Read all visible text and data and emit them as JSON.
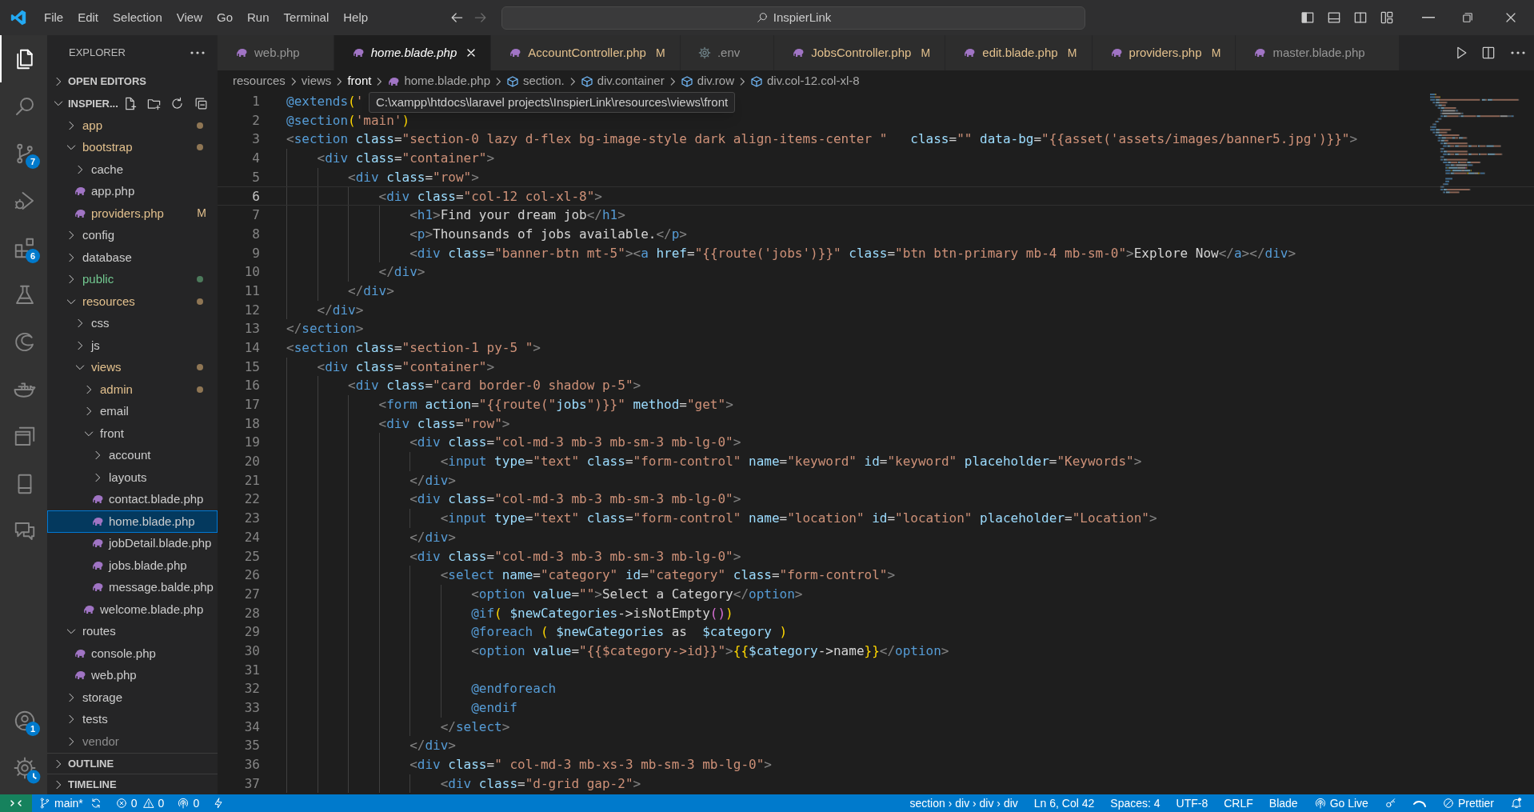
{
  "title_bar": {
    "menus": [
      "File",
      "Edit",
      "Selection",
      "View",
      "Go",
      "Run",
      "Terminal",
      "Help"
    ],
    "search": "InspierLink"
  },
  "activity_bar": {
    "items": [
      {
        "kind": "files",
        "selected": true
      },
      {
        "kind": "search",
        "selected": false
      },
      {
        "kind": "branch",
        "badge": "7",
        "selected": false
      },
      {
        "kind": "debug",
        "selected": false
      },
      {
        "kind": "blocks",
        "badge": "6",
        "selected": false
      },
      {
        "kind": "flask",
        "selected": false
      },
      {
        "kind": "swirl",
        "selected": false
      },
      {
        "kind": "whale",
        "selected": false
      },
      {
        "kind": "windows",
        "selected": false
      },
      {
        "kind": "device",
        "selected": false
      },
      {
        "kind": "chat",
        "selected": false
      }
    ],
    "bottom": [
      {
        "kind": "account",
        "badge": "1",
        "selected": false
      },
      {
        "kind": "gear",
        "selected": false
      }
    ]
  },
  "sidebar": {
    "title": "EXPLORER",
    "open_editors": {
      "label": "OPEN EDITORS",
      "expanded": false
    },
    "root": {
      "label": "INSPIER...",
      "expanded": true
    },
    "tree": [
      {
        "name": "app",
        "kind": "folder",
        "expanded": false,
        "modified": true,
        "untracked": false,
        "ignored": false,
        "dot": true,
        "selected": false
      },
      {
        "name": "bootstrap",
        "kind": "folder",
        "expanded": true,
        "modified": true,
        "untracked": false,
        "ignored": false,
        "dot": true,
        "selected": false,
        "children": [
          {
            "name": "cache",
            "kind": "folder",
            "expanded": false,
            "modified": false,
            "untracked": false,
            "ignored": false,
            "dot": false,
            "selected": false
          },
          {
            "name": "app.php",
            "kind": "file",
            "modified": false,
            "untracked": false,
            "ignored": false,
            "selected": false
          },
          {
            "name": "providers.php",
            "kind": "file",
            "modified": true,
            "untracked": false,
            "ignored": false,
            "badge": "M",
            "selected": false
          }
        ]
      },
      {
        "name": "config",
        "kind": "folder",
        "expanded": false,
        "modified": false,
        "untracked": false,
        "ignored": false,
        "dot": false,
        "selected": false
      },
      {
        "name": "database",
        "kind": "folder",
        "expanded": false,
        "modified": false,
        "untracked": false,
        "ignored": false,
        "dot": false,
        "selected": false
      },
      {
        "name": "public",
        "kind": "folder",
        "expanded": false,
        "modified": false,
        "untracked": true,
        "ignored": false,
        "dot": true,
        "selected": false
      },
      {
        "name": "resources",
        "kind": "folder",
        "expanded": true,
        "modified": true,
        "untracked": false,
        "ignored": false,
        "dot": true,
        "selected": false,
        "children": [
          {
            "name": "css",
            "kind": "folder",
            "expanded": false,
            "modified": false,
            "untracked": false,
            "ignored": false,
            "dot": false,
            "selected": false
          },
          {
            "name": "js",
            "kind": "folder",
            "expanded": false,
            "modified": false,
            "untracked": false,
            "ignored": false,
            "dot": false,
            "selected": false
          },
          {
            "name": "views",
            "kind": "folder",
            "expanded": true,
            "modified": true,
            "untracked": false,
            "ignored": false,
            "dot": true,
            "selected": false,
            "children": [
              {
                "name": "admin",
                "kind": "folder",
                "expanded": false,
                "modified": true,
                "untracked": false,
                "ignored": false,
                "dot": true,
                "selected": false
              },
              {
                "name": "email",
                "kind": "folder",
                "expanded": false,
                "modified": false,
                "untracked": false,
                "ignored": false,
                "dot": false,
                "selected": false
              },
              {
                "name": "front",
                "kind": "folder",
                "expanded": true,
                "modified": false,
                "untracked": false,
                "ignored": false,
                "dot": false,
                "selected": false,
                "children": [
                  {
                    "name": "account",
                    "kind": "folder",
                    "expanded": false,
                    "modified": false,
                    "untracked": false,
                    "ignored": false,
                    "dot": false,
                    "selected": false
                  },
                  {
                    "name": "layouts",
                    "kind": "folder",
                    "expanded": false,
                    "modified": false,
                    "untracked": false,
                    "ignored": false,
                    "dot": false,
                    "selected": false
                  },
                  {
                    "name": "contact.blade.php",
                    "kind": "file",
                    "modified": false,
                    "untracked": false,
                    "ignored": false,
                    "selected": false
                  },
                  {
                    "name": "home.blade.php",
                    "kind": "file",
                    "modified": false,
                    "untracked": false,
                    "ignored": false,
                    "selected": true
                  },
                  {
                    "name": "jobDetail.blade.php",
                    "kind": "file",
                    "modified": false,
                    "untracked": false,
                    "ignored": false,
                    "selected": false
                  },
                  {
                    "name": "jobs.blade.php",
                    "kind": "file",
                    "modified": false,
                    "untracked": false,
                    "ignored": false,
                    "selected": false
                  },
                  {
                    "name": "message.balde.php",
                    "kind": "file",
                    "modified": false,
                    "untracked": false,
                    "ignored": false,
                    "selected": false
                  }
                ]
              },
              {
                "name": "welcome.blade.php",
                "kind": "file",
                "modified": false,
                "untracked": false,
                "ignored": false,
                "selected": false
              }
            ]
          }
        ]
      },
      {
        "name": "routes",
        "kind": "folder",
        "expanded": true,
        "modified": false,
        "untracked": false,
        "ignored": false,
        "dot": false,
        "selected": false,
        "children": [
          {
            "name": "console.php",
            "kind": "file",
            "modified": false,
            "untracked": false,
            "ignored": false,
            "selected": false
          },
          {
            "name": "web.php",
            "kind": "file",
            "modified": false,
            "untracked": false,
            "ignored": false,
            "selected": false
          }
        ]
      },
      {
        "name": "storage",
        "kind": "folder",
        "expanded": false,
        "modified": false,
        "untracked": false,
        "ignored": false,
        "dot": false,
        "selected": false
      },
      {
        "name": "tests",
        "kind": "folder",
        "expanded": false,
        "modified": false,
        "untracked": false,
        "ignored": false,
        "dot": false,
        "selected": false
      },
      {
        "name": "vendor",
        "kind": "folder",
        "expanded": false,
        "modified": false,
        "untracked": false,
        "ignored": true,
        "dot": false,
        "selected": false
      }
    ],
    "panels": [
      {
        "label": "OUTLINE",
        "expanded": false
      },
      {
        "label": "TIMELINE",
        "expanded": false
      }
    ]
  },
  "tabs": [
    {
      "label": "web.php",
      "kind": "php",
      "selected": false,
      "preview": false
    },
    {
      "label": "home.blade.php",
      "kind": "php",
      "selected": true,
      "preview": true
    },
    {
      "label": "AccountController.php",
      "kind": "php",
      "badge": "M",
      "selected": false,
      "preview": false
    },
    {
      "label": ".env",
      "kind": "settings",
      "selected": false,
      "preview": false
    },
    {
      "label": "JobsController.php",
      "kind": "php",
      "badge": "M",
      "selected": false,
      "preview": false
    },
    {
      "label": "edit.blade.php",
      "kind": "php",
      "badge": "M",
      "selected": false,
      "preview": false
    },
    {
      "label": "providers.php",
      "kind": "php",
      "badge": "M",
      "selected": false,
      "preview": false
    },
    {
      "label": "master.blade.php",
      "kind": "php",
      "selected": false,
      "preview": false
    }
  ],
  "breadcrumb": [
    {
      "label": "resources",
      "kind": "folder",
      "selected": false
    },
    {
      "label": "views",
      "kind": "folder",
      "selected": false
    },
    {
      "label": "front",
      "kind": "folder",
      "selected": true
    },
    {
      "label": "home.blade.php",
      "kind": "php",
      "selected": false
    },
    {
      "label": "section.",
      "kind": "symbol",
      "selected": false
    },
    {
      "label": "div.container",
      "kind": "symbol",
      "selected": false
    },
    {
      "label": "div.row",
      "kind": "symbol",
      "selected": false
    },
    {
      "label": "div.col-12.col-xl-8",
      "kind": "symbol",
      "selected": false
    }
  ],
  "tooltip": "C:\\xampp\\htdocs\\laravel projects\\InspierLink\\resources\\views\\front",
  "editor": {
    "lines": [
      {
        "number": "1",
        "code": "@extends('",
        "current": false
      },
      {
        "number": "2",
        "code": "@section('main')",
        "current": false
      },
      {
        "number": "3",
        "code": "<section class=\"section-0 lazy d-flex bg-image-style dark align-items-center \"   class=\"\" data-bg=\"{{asset('assets/images/banner5.jpg')}}\">",
        "current": false
      },
      {
        "number": "4",
        "code": "    <div class=\"container\">",
        "current": false
      },
      {
        "number": "5",
        "code": "        <div class=\"row\">",
        "current": false
      },
      {
        "number": "6",
        "code": "            <div class=\"col-12 col-xl-8\">",
        "current": true
      },
      {
        "number": "7",
        "code": "                <h1>Find your dream job</h1>",
        "current": false
      },
      {
        "number": "8",
        "code": "                <p>Thounsands of jobs available.</p>",
        "current": false
      },
      {
        "number": "9",
        "code": "                <div class=\"banner-btn mt-5\"><a href=\"{{route('jobs')}}\" class=\"btn btn-primary mb-4 mb-sm-0\">Explore Now</a></div>",
        "current": false
      },
      {
        "number": "10",
        "code": "            </div>",
        "current": false
      },
      {
        "number": "11",
        "code": "        </div>",
        "current": false
      },
      {
        "number": "12",
        "code": "    </div>",
        "current": false
      },
      {
        "number": "13",
        "code": "</section>",
        "current": false
      },
      {
        "number": "14",
        "code": "<section class=\"section-1 py-5 \">",
        "current": false
      },
      {
        "number": "15",
        "code": "    <div class=\"container\">",
        "current": false
      },
      {
        "number": "16",
        "code": "        <div class=\"card border-0 shadow p-5\">",
        "current": false
      },
      {
        "number": "17",
        "code": "            <form action=\"{{route(\"jobs\")}}\" method=\"get\">",
        "current": false
      },
      {
        "number": "18",
        "code": "            <div class=\"row\">",
        "current": false
      },
      {
        "number": "19",
        "code": "                <div class=\"col-md-3 mb-3 mb-sm-3 mb-lg-0\">",
        "current": false
      },
      {
        "number": "20",
        "code": "                    <input type=\"text\" class=\"form-control\" name=\"keyword\" id=\"keyword\" placeholder=\"Keywords\">",
        "current": false
      },
      {
        "number": "21",
        "code": "                </div>",
        "current": false
      },
      {
        "number": "22",
        "code": "                <div class=\"col-md-3 mb-3 mb-sm-3 mb-lg-0\">",
        "current": false
      },
      {
        "number": "23",
        "code": "                    <input type=\"text\" class=\"form-control\" name=\"location\" id=\"location\" placeholder=\"Location\">",
        "current": false
      },
      {
        "number": "24",
        "code": "                </div>",
        "current": false
      },
      {
        "number": "25",
        "code": "                <div class=\"col-md-3 mb-3 mb-sm-3 mb-lg-0\">",
        "current": false
      },
      {
        "number": "26",
        "code": "                    <select name=\"category\" id=\"category\" class=\"form-control\">",
        "current": false
      },
      {
        "number": "27",
        "code": "                        <option value=\"\">Select a Category</option>",
        "current": false
      },
      {
        "number": "28",
        "code": "                        @if( $newCategories->isNotEmpty())",
        "current": false
      },
      {
        "number": "29",
        "code": "                        @foreach ( $newCategories as  $category )",
        "current": false
      },
      {
        "number": "30",
        "code": "                        <option value=\"{{$category->id}}\">{{$category->name}}</option>",
        "current": false
      },
      {
        "number": "31",
        "current": false
      },
      {
        "number": "32",
        "code": "                        @endforeach",
        "current": false
      },
      {
        "number": "33",
        "code": "                        @endif",
        "current": false
      },
      {
        "number": "34",
        "code": "                    </select>",
        "current": false
      },
      {
        "number": "35",
        "code": "                </div>",
        "current": false
      },
      {
        "number": "36",
        "code": "                <div class=\" col-md-3 mb-xs-3 mb-sm-3 mb-lg-0\">",
        "current": false
      },
      {
        "number": "37",
        "code": "                    <div class=\"d-grid gap-2\">",
        "current": false
      }
    ]
  },
  "status_bar": {
    "branch": "main*",
    "errors": "0",
    "warnings": "0",
    "ports": "0",
    "right": [
      {
        "kind": "text",
        "text": "section › div › div › div"
      },
      {
        "kind": "text",
        "text": "Ln 6, Col 42"
      },
      {
        "kind": "text",
        "text": "Spaces: 4"
      },
      {
        "kind": "text",
        "text": "UTF-8"
      },
      {
        "kind": "text",
        "text": "CRLF"
      },
      {
        "kind": "text",
        "text": "Blade"
      },
      {
        "kind": "golive",
        "text": "Go Live"
      },
      {
        "kind": "key"
      },
      {
        "kind": "spinner"
      },
      {
        "kind": "prettier",
        "text": "Prettier"
      },
      {
        "kind": "bell"
      }
    ]
  }
}
